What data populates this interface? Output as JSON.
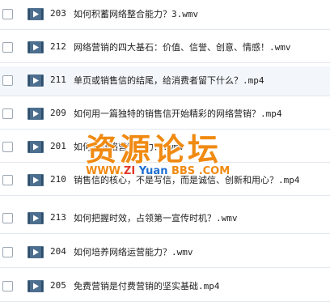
{
  "rows": [
    {
      "num": "203",
      "title": "如何积蓄网络整合能力？3.wmv"
    },
    {
      "num": "212",
      "title": "网络营销的四大基石：价值、信誉、创意、情感！.wmv"
    },
    {
      "num": "211",
      "title": "单页或销售信的结尾，给消费者留下什么？.mp4"
    },
    {
      "num": "209",
      "title": "如何用一篇独特的销售信开始精彩的网络营销？.mp4"
    },
    {
      "num": "201",
      "title": "如何做网络营销能力？.wmv"
    },
    {
      "num": "210",
      "title": "销售信的核心，不是写信，而是诚信、创新和用心？.mp4"
    },
    {
      "num": "213",
      "title": "如何把握时效，占领第一宣传时机？.wmv"
    },
    {
      "num": "204",
      "title": "如何培养网络运营能力？.wmv"
    },
    {
      "num": "205",
      "title": "免费营销是付费营销的坚实基础.mp4"
    }
  ],
  "watermark": {
    "main": "资源论坛",
    "www": "WWW.",
    "zi": "ZI",
    "yuan": " Yuan ",
    "bbs": "BBS",
    "com": " .COM"
  },
  "colors": {
    "icon_bg": "#4d6f8f",
    "icon_play": "#ffffff",
    "watermark_orange": "#f08a12",
    "watermark_blue": "#1f6fd1",
    "watermark_red": "#e23a2a"
  }
}
